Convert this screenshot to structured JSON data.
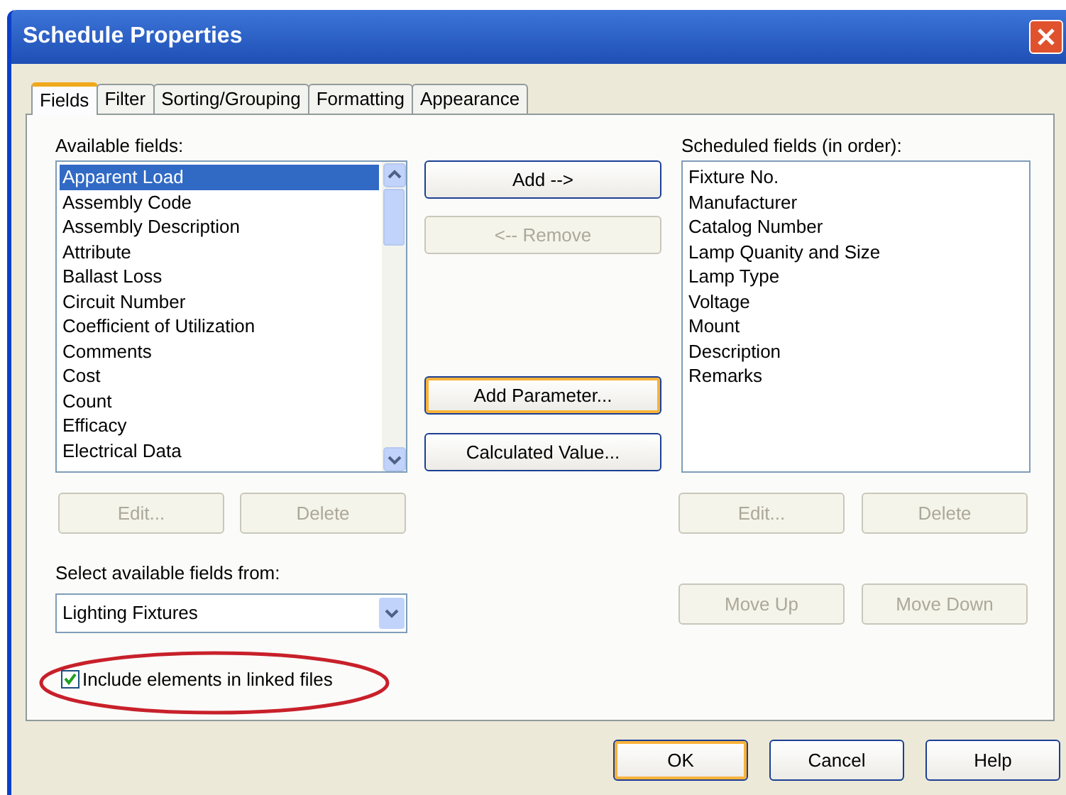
{
  "window": {
    "title": "Schedule Properties"
  },
  "tabs": [
    {
      "label": "Fields",
      "selected": true
    },
    {
      "label": "Filter",
      "selected": false
    },
    {
      "label": "Sorting/Grouping",
      "selected": false
    },
    {
      "label": "Formatting",
      "selected": false
    },
    {
      "label": "Appearance",
      "selected": false
    }
  ],
  "available": {
    "label": "Available fields:",
    "items": [
      {
        "label": "Apparent Load",
        "selected": true
      },
      {
        "label": "Assembly Code",
        "selected": false
      },
      {
        "label": "Assembly Description",
        "selected": false
      },
      {
        "label": "Attribute",
        "selected": false
      },
      {
        "label": "Ballast Loss",
        "selected": false
      },
      {
        "label": "Circuit Number",
        "selected": false
      },
      {
        "label": "Coefficient of Utilization",
        "selected": false
      },
      {
        "label": "Comments",
        "selected": false
      },
      {
        "label": "Cost",
        "selected": false
      },
      {
        "label": "Count",
        "selected": false
      },
      {
        "label": "Efficacy",
        "selected": false
      },
      {
        "label": "Electrical Data",
        "selected": false
      }
    ],
    "buttons": [
      {
        "label": "Edit...",
        "disabled": true
      },
      {
        "label": "Delete",
        "disabled": true
      }
    ]
  },
  "middle_buttons_top": [
    {
      "label": "Add -->",
      "disabled": false,
      "focused": false
    },
    {
      "label": "<-- Remove",
      "disabled": true,
      "focused": false
    }
  ],
  "middle_buttons_bottom": [
    {
      "label": "Add Parameter...",
      "disabled": false,
      "focused": true
    },
    {
      "label": "Calculated Value...",
      "disabled": false,
      "focused": false
    }
  ],
  "scheduled": {
    "label": "Scheduled fields (in order):",
    "items": [
      {
        "label": "Fixture No.",
        "selected": false
      },
      {
        "label": "Manufacturer",
        "selected": false
      },
      {
        "label": "Catalog Number",
        "selected": false
      },
      {
        "label": "Lamp Quanity and Size",
        "selected": false
      },
      {
        "label": "Lamp Type",
        "selected": false
      },
      {
        "label": "Voltage",
        "selected": false
      },
      {
        "label": "Mount",
        "selected": false
      },
      {
        "label": "Description",
        "selected": false
      },
      {
        "label": "Remarks",
        "selected": false
      }
    ],
    "buttons": [
      {
        "label": "Edit...",
        "disabled": true
      },
      {
        "label": "Delete",
        "disabled": true
      }
    ],
    "move_buttons": [
      {
        "label": "Move Up",
        "disabled": true
      },
      {
        "label": "Move Down",
        "disabled": true
      }
    ]
  },
  "source": {
    "label": "Select available fields from:",
    "value": "Lighting Fixtures"
  },
  "include_linked": {
    "label": "Include elements in linked files",
    "checked": true,
    "highlighted": true
  },
  "footer_buttons": [
    {
      "label": "OK",
      "disabled": false,
      "focused": true
    },
    {
      "label": "Cancel",
      "disabled": false,
      "focused": false
    },
    {
      "label": "Help",
      "disabled": false,
      "focused": false
    }
  ]
}
